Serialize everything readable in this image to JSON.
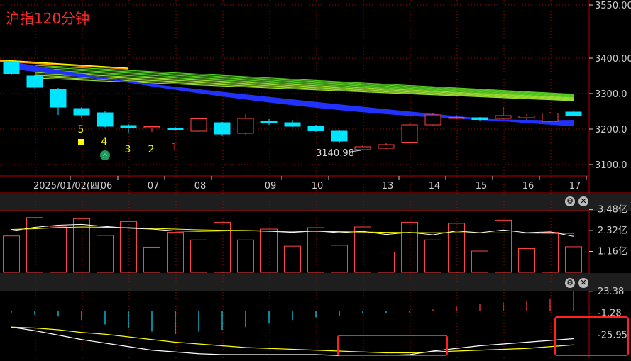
{
  "title": "沪指120分钟",
  "colors": {
    "up": "#ff4444",
    "down": "#00e5ff",
    "ma_short": "#ffff00",
    "ma_long_band": "#66cc33",
    "ma_blue_band": "#2233ff",
    "grid": "#b40000",
    "axis_text": "#cfcfcf",
    "highlight_box": "#ff2020"
  },
  "panel_controls": {
    "settings_icon": "gear-icon",
    "close_icon": "close-icon"
  },
  "chart_data": [
    {
      "type": "candlestick",
      "panel": "price",
      "x": [
        "",
        "2025/01/02(四)",
        "",
        "",
        "06",
        "",
        "07",
        "",
        "08",
        "",
        "",
        "09",
        "",
        "10",
        "",
        "",
        "13",
        "",
        "14",
        "",
        "15",
        "",
        "16",
        "",
        "17"
      ],
      "xtick_labels": [
        "2025/01/02(四)",
        "06",
        "07",
        "08",
        "09",
        "10",
        "13",
        "14",
        "15",
        "16",
        "17"
      ],
      "ohlc": [
        [
          3390,
          3395,
          3352,
          3355
        ],
        [
          3350,
          3352,
          3315,
          3318
        ],
        [
          3312,
          3316,
          3240,
          3262
        ],
        [
          3258,
          3262,
          3232,
          3240
        ],
        [
          3246,
          3250,
          3205,
          3208
        ],
        [
          3210,
          3214,
          3188,
          3205
        ],
        [
          3205,
          3210,
          3192,
          3207
        ],
        [
          3202,
          3206,
          3195,
          3198
        ],
        [
          3194,
          3232,
          3192,
          3229
        ],
        [
          3218,
          3220,
          3180,
          3186
        ],
        [
          3188,
          3242,
          3185,
          3230
        ],
        [
          3222,
          3228,
          3212,
          3221
        ],
        [
          3218,
          3226,
          3206,
          3208
        ],
        [
          3208,
          3212,
          3192,
          3195
        ],
        [
          3194,
          3198,
          3160,
          3166
        ],
        [
          3142,
          3155,
          3141,
          3150
        ],
        [
          3146,
          3160,
          3144,
          3156
        ],
        [
          3163,
          3215,
          3160,
          3212
        ],
        [
          3212,
          3245,
          3210,
          3240
        ],
        [
          3233,
          3240,
          3228,
          3233
        ],
        [
          3232,
          3234,
          3224,
          3227
        ],
        [
          3230,
          3262,
          3228,
          3238
        ],
        [
          3232,
          3242,
          3226,
          3237
        ],
        [
          3222,
          3248,
          3220,
          3245
        ],
        [
          3248,
          3252,
          3236,
          3239
        ]
      ],
      "ylim": [
        3075,
        3560
      ],
      "yticks": [
        "3550.00",
        "3400.00",
        "3300.0",
        "3200.0",
        "3100.0"
      ],
      "annotations": [
        "5",
        "4",
        "3",
        "2",
        "1",
        "3140.98"
      ],
      "badge_icon": "star-badge-icon",
      "grid": true
    },
    {
      "type": "bar",
      "panel": "volume",
      "unit": "亿",
      "values": [
        2.02,
        3.04,
        2.52,
        2.98,
        2.05,
        2.82,
        1.4,
        2.22,
        1.8,
        2.78,
        1.8,
        2.4,
        1.45,
        2.48,
        1.5,
        2.52,
        1.12,
        2.78,
        1.8,
        2.72,
        1.18,
        2.9,
        1.32,
        2.22,
        1.42
      ],
      "up": [
        false,
        true,
        true,
        true,
        true,
        true,
        false,
        true,
        true,
        true,
        true,
        true,
        true,
        true,
        true,
        true,
        true,
        true,
        true,
        true,
        true,
        true,
        true,
        true,
        true
      ],
      "yticks": [
        "3.48亿",
        "2.32亿",
        "1.16亿"
      ],
      "ylim": [
        0,
        3.6
      ],
      "series": [
        {
          "values": [
            2.3,
            2.5,
            2.62,
            2.66,
            2.55,
            2.45,
            2.4,
            2.3,
            2.28,
            2.3,
            2.32,
            2.28,
            2.22,
            2.3,
            2.2,
            2.28,
            2.1,
            2.22,
            2.08,
            2.3,
            2.2,
            2.35,
            2.2,
            2.25,
            2.0
          ]
        },
        {
          "values": [
            2.38,
            2.42,
            2.48,
            2.52,
            2.5,
            2.48,
            2.44,
            2.4,
            2.36,
            2.34,
            2.33,
            2.3,
            2.28,
            2.28,
            2.26,
            2.24,
            2.22,
            2.21,
            2.2,
            2.2,
            2.19,
            2.19,
            2.18,
            2.17,
            2.17
          ]
        }
      ]
    },
    {
      "type": "bar",
      "panel": "macd",
      "yticks": [
        "23.38",
        "-1.28",
        "-25.95"
      ],
      "ylim": [
        -35,
        30
      ],
      "values": [
        -0.5,
        -3,
        -5,
        -9,
        -14,
        -18,
        -22,
        -25,
        -22,
        -20,
        -17,
        -13,
        -9,
        -6,
        -4,
        -2,
        -1,
        -0.5,
        3,
        6,
        9,
        11,
        13,
        15,
        23
      ],
      "series": [
        {
          "values": [
            -1,
            -5,
            -10,
            -15,
            -19,
            -23,
            -27,
            -29,
            -31,
            -32,
            -32,
            -32,
            -32,
            -32,
            -33,
            -33,
            -33,
            -32,
            -28,
            -25,
            -22,
            -20,
            -18,
            -16,
            -14
          ]
        },
        {
          "values": [
            -1,
            -2,
            -4,
            -7,
            -9,
            -12,
            -15,
            -18,
            -20,
            -22,
            -24,
            -25,
            -26,
            -27,
            -28,
            -29,
            -30,
            -30,
            -29,
            -28,
            -27,
            -26,
            -25,
            -23,
            -21
          ]
        }
      ]
    }
  ]
}
